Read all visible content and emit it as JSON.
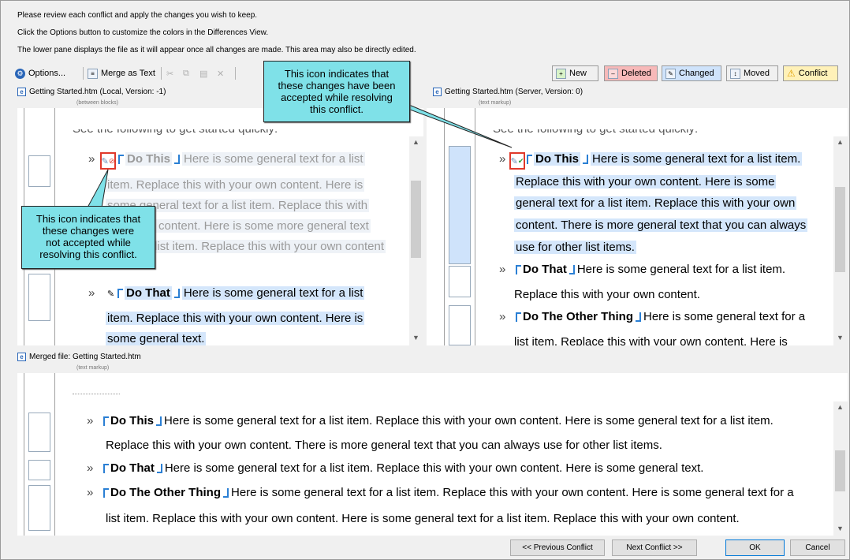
{
  "instructions": [
    "Please review each conflict and apply the changes you wish to keep.",
    "Click the Options button to customize the colors in the Differences View.",
    "The lower pane displays the file as it will appear once all changes are made. This area may also be directly edited."
  ],
  "toolbar": {
    "options_label": "Options...",
    "merge_text_label": "Merge as Text"
  },
  "legend": {
    "new": "New",
    "deleted": "Deleted",
    "changed": "Changed",
    "moved": "Moved",
    "conflict": "Conflict"
  },
  "colors": {
    "new": "#d9f3c8",
    "deleted": "#f7b9b9",
    "changed": "#cfe3fb",
    "moved": "#ffffff",
    "conflict": "#fff1b8",
    "callout": "#7fe1e8",
    "highlight": "#e0392b"
  },
  "left_pane": {
    "title": "Getting Started.htm (Local, Version: -1)",
    "subtitle": "(between blocks)",
    "cut_line": "See the following to get started quickly:",
    "item1": {
      "label": "Do This",
      "lines": [
        "Here is some general text for a list",
        "item. Replace this with your own content. Here is",
        "some general text for a list item. Replace this with",
        "your own content. Here is some more general text",
        "for other list item. Replace this with your own content"
      ]
    },
    "item2": {
      "label": "Do That",
      "lines": [
        "Here is some general text for a list",
        "item. Replace this with your own content. Here is",
        "some general text."
      ]
    }
  },
  "right_pane": {
    "title": "Getting Started.htm (Server, Version: 0)",
    "subtitle": "(text markup)",
    "cut_line": "See the following to get started quickly:",
    "item1": {
      "label": "Do This",
      "lines": [
        "Here is some general text for a list item.",
        "Replace this with your own content. Here is some",
        "general text for a list item. Replace this with your own",
        "content. There is more general text that you can always",
        "use for other list items."
      ]
    },
    "item2": {
      "label": "Do That",
      "lines": [
        "Here is some general text for a list item.",
        "Replace this with your own content."
      ]
    },
    "item3": {
      "label": "Do The Other Thing",
      "lines": [
        "Here is some general text for a",
        "list item. Replace this with your own content. Here is"
      ]
    }
  },
  "merged_pane": {
    "title": "Merged file: Getting Started.htm",
    "subtitle": "(text markup)",
    "item1": {
      "label": "Do This",
      "lines": [
        "Here is some general text for a list item. Replace this with your own content. Here is some general text for a list item.",
        "Replace this with your own content. There is more general text that you can always use for other list items."
      ]
    },
    "item2": {
      "label": "Do That",
      "lines": [
        "Here is some general text for a list item. Replace this with your own content. Here is some general text."
      ]
    },
    "item3": {
      "label": "Do The Other Thing",
      "lines": [
        "Here is some general text for a list item. Replace this with your own content. Here is some general text for a",
        "list item. Replace this with your own content. Here is some general text for a list item. Replace this with your own content."
      ]
    }
  },
  "callouts": {
    "accepted": [
      "This icon indicates that",
      "these changes have been",
      "accepted while resolving",
      "this conflict."
    ],
    "rejected": [
      "This icon indicates that",
      "these changes were",
      "not accepted while",
      "resolving this conflict."
    ]
  },
  "buttons": {
    "previous": "<< Previous Conflict",
    "next": "Next Conflict >>",
    "ok": "OK",
    "cancel": "Cancel"
  },
  "bullet_glyph": "»"
}
